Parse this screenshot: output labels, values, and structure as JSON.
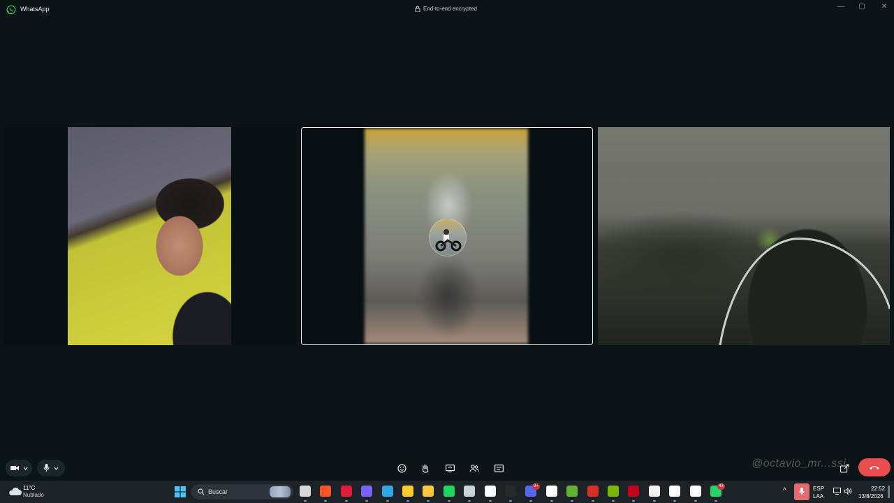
{
  "window": {
    "app_name": "WhatsApp",
    "encryption_text": "End-to-end encrypted",
    "controls": {
      "minimize": "—",
      "maximize": "▢",
      "close": "✕"
    }
  },
  "participants": [
    {
      "name": "participant-1",
      "active": false,
      "icon": "camera-feed"
    },
    {
      "name": "participant-2",
      "active": true,
      "icon": "avatar-motorcycle"
    },
    {
      "name": "participant-3",
      "active": false,
      "icon": "camera-feed"
    }
  ],
  "call_controls": {
    "left": [
      {
        "name": "camera-toggle",
        "icon": "video-camera-icon"
      },
      {
        "name": "microphone-toggle",
        "icon": "microphone-icon"
      }
    ],
    "center": [
      {
        "name": "reactions",
        "icon": "smiley-icon"
      },
      {
        "name": "raise-hand",
        "icon": "hand-icon"
      },
      {
        "name": "share-screen",
        "icon": "screen-share-icon"
      },
      {
        "name": "participants",
        "icon": "people-icon"
      },
      {
        "name": "captions",
        "icon": "caption-icon"
      }
    ],
    "watermark": "@octavio_mr...ssi"
  },
  "taskbar": {
    "weather": {
      "temp": "11°C",
      "desc": "Nublado"
    },
    "search_placeholder": "Buscar",
    "apps": [
      {
        "name": "file-manager",
        "color": "#d8d8d8"
      },
      {
        "name": "brave",
        "color": "#fb542b"
      },
      {
        "name": "opera-gx",
        "color": "#e01b3c"
      },
      {
        "name": "copilot",
        "color": "#7b61ff"
      },
      {
        "name": "edge",
        "color": "#2fa7e6"
      },
      {
        "name": "chrome",
        "color": "#ffcb2f"
      },
      {
        "name": "explorer",
        "color": "#ffc83d"
      },
      {
        "name": "spotify",
        "color": "#1ed760"
      },
      {
        "name": "steam",
        "color": "#c7d5e0"
      },
      {
        "name": "store",
        "color": "#ffffff"
      },
      {
        "name": "epic-games",
        "color": "#2a2a2a"
      },
      {
        "name": "discord",
        "color": "#5865f2",
        "badge": "9+"
      },
      {
        "name": "app-x",
        "color": "#ffffff"
      },
      {
        "name": "minecraft",
        "color": "#62b22f"
      },
      {
        "name": "red-app",
        "color": "#d93025"
      },
      {
        "name": "nvidia",
        "color": "#76b900"
      },
      {
        "name": "game-app",
        "color": "#c4001f"
      },
      {
        "name": "cloud-app",
        "color": "#f2f2f2"
      },
      {
        "name": "obs",
        "color": "#ffffff"
      },
      {
        "name": "capcut",
        "color": "#ffffff"
      },
      {
        "name": "whatsapp",
        "color": "#25d366",
        "badge": "43"
      }
    ],
    "tray": {
      "lang": "ESP",
      "layout": "LAA",
      "time": "22:52",
      "date": "13/8/2026"
    }
  }
}
